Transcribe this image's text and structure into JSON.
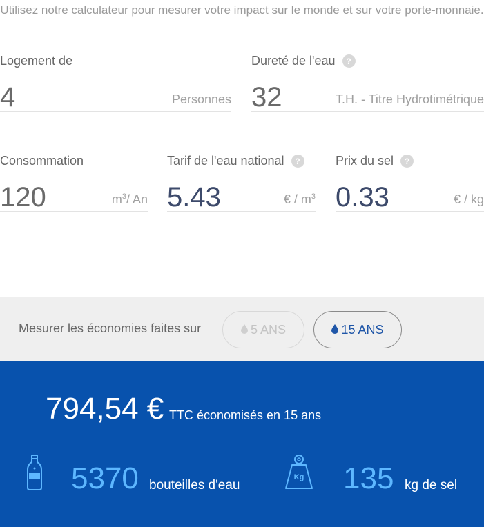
{
  "intro_text": "Utilisez notre calculateur pour mesurer votre impact sur le monde et sur votre porte-monnaie.",
  "fields": {
    "logement": {
      "label": "Logement de",
      "value": "4",
      "unit": "Personnes"
    },
    "durete": {
      "label": "Dureté de l'eau",
      "value": "32",
      "unit": "T.H. - Titre Hydrotimétrique"
    },
    "consommation": {
      "label": "Consommation",
      "value": "120",
      "unit": "m",
      "unit_sup": "3",
      "unit_tail": "/ An"
    },
    "tarif": {
      "label": "Tarif de l'eau national",
      "value": "5.43",
      "unit": "€ / m",
      "unit_sup": "3"
    },
    "sel": {
      "label": "Prix du sel",
      "value": "0.33",
      "unit": "€ / kg"
    }
  },
  "help_glyph": "?",
  "savings_bar": {
    "label": "Mesurer les économies faites sur",
    "option_5": "5 ANS",
    "option_15": "15 ANS",
    "selected": "15 ANS"
  },
  "results": {
    "amount": "794,54 €",
    "amount_caption": "TTC économisés en 15 ans",
    "bottles_value": "5370",
    "bottles_label": "bouteilles d'eau",
    "salt_value": "135",
    "salt_label": "kg de sel",
    "weight_icon_text": "Kg"
  },
  "colors": {
    "results_bg": "#0852ad",
    "highlight": "#5db7ff",
    "accent": "#1f56a8"
  }
}
